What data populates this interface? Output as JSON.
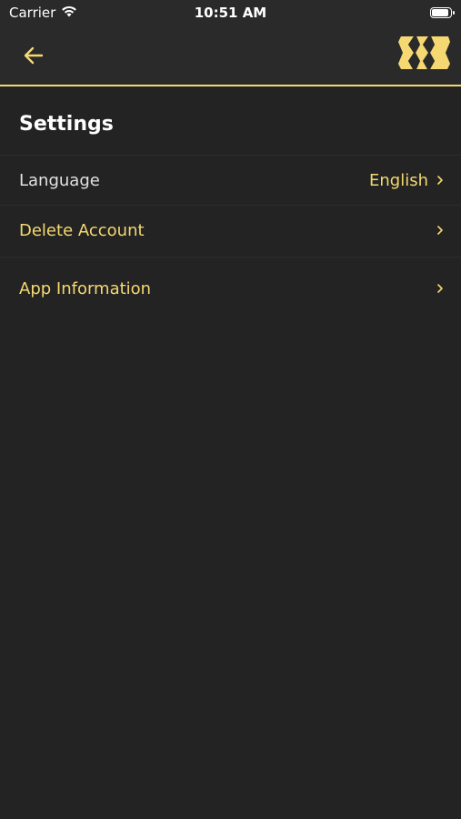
{
  "status_bar": {
    "carrier": "Carrier",
    "time": "10:51 AM",
    "wifi_icon": "wifi-icon",
    "battery_icon": "battery-icon"
  },
  "nav_bar": {
    "back_icon": "arrow-left-icon",
    "logo_icon": "brand-logo-icon",
    "accent_color": "#f5d871"
  },
  "page": {
    "title": "Settings"
  },
  "settings": {
    "items": [
      {
        "label": "Language",
        "value": "English",
        "icon": "chevron-right-icon"
      },
      {
        "label": "Delete Account",
        "value": "",
        "icon": "chevron-right-icon"
      },
      {
        "label": "App Information",
        "value": "",
        "icon": "chevron-right-icon"
      }
    ]
  }
}
